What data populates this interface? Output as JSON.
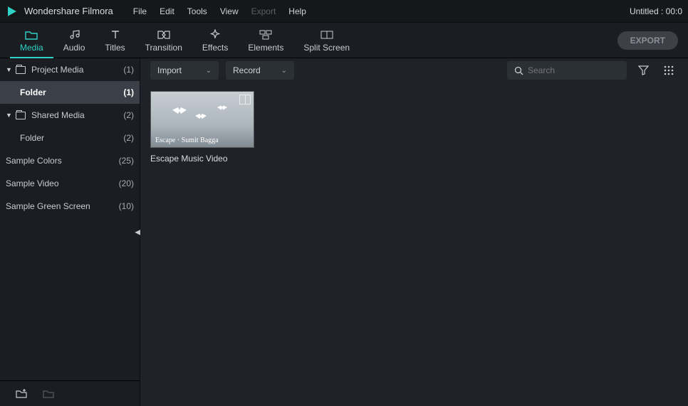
{
  "app": {
    "title": "Wondershare Filmora"
  },
  "menubar": {
    "items": [
      {
        "label": "File",
        "disabled": false
      },
      {
        "label": "Edit",
        "disabled": false
      },
      {
        "label": "Tools",
        "disabled": false
      },
      {
        "label": "View",
        "disabled": false
      },
      {
        "label": "Export",
        "disabled": true
      },
      {
        "label": "Help",
        "disabled": false
      }
    ]
  },
  "project": {
    "title": "Untitled : 00:0"
  },
  "tabs": {
    "items": [
      {
        "label": "Media",
        "icon": "folder-icon"
      },
      {
        "label": "Audio",
        "icon": "music-icon"
      },
      {
        "label": "Titles",
        "icon": "text-icon"
      },
      {
        "label": "Transition",
        "icon": "transition-icon"
      },
      {
        "label": "Effects",
        "icon": "effects-icon"
      },
      {
        "label": "Elements",
        "icon": "elements-icon"
      },
      {
        "label": "Split Screen",
        "icon": "split-icon"
      }
    ],
    "active": 0,
    "export_label": "EXPORT"
  },
  "sidebar": {
    "items": [
      {
        "label": "Project Media",
        "count": "(1)",
        "type": "root",
        "expanded": true,
        "hasFolderIcon": true
      },
      {
        "label": "Folder",
        "count": "(1)",
        "type": "child",
        "selected": true
      },
      {
        "label": "Shared Media",
        "count": "(2)",
        "type": "root",
        "expanded": true,
        "hasFolderIcon": true
      },
      {
        "label": "Folder",
        "count": "(2)",
        "type": "child"
      },
      {
        "label": "Sample Colors",
        "count": "(25)",
        "type": "leaf"
      },
      {
        "label": "Sample Video",
        "count": "(20)",
        "type": "leaf"
      },
      {
        "label": "Sample Green Screen",
        "count": "(10)",
        "type": "leaf"
      }
    ]
  },
  "panel_toolbar": {
    "import_label": "Import",
    "record_label": "Record",
    "search_placeholder": "Search"
  },
  "media": {
    "items": [
      {
        "caption": "Escape Music Video",
        "overlay": "Escape · Sumit Bagga"
      }
    ]
  },
  "colors": {
    "accent": "#2ed1c6"
  }
}
